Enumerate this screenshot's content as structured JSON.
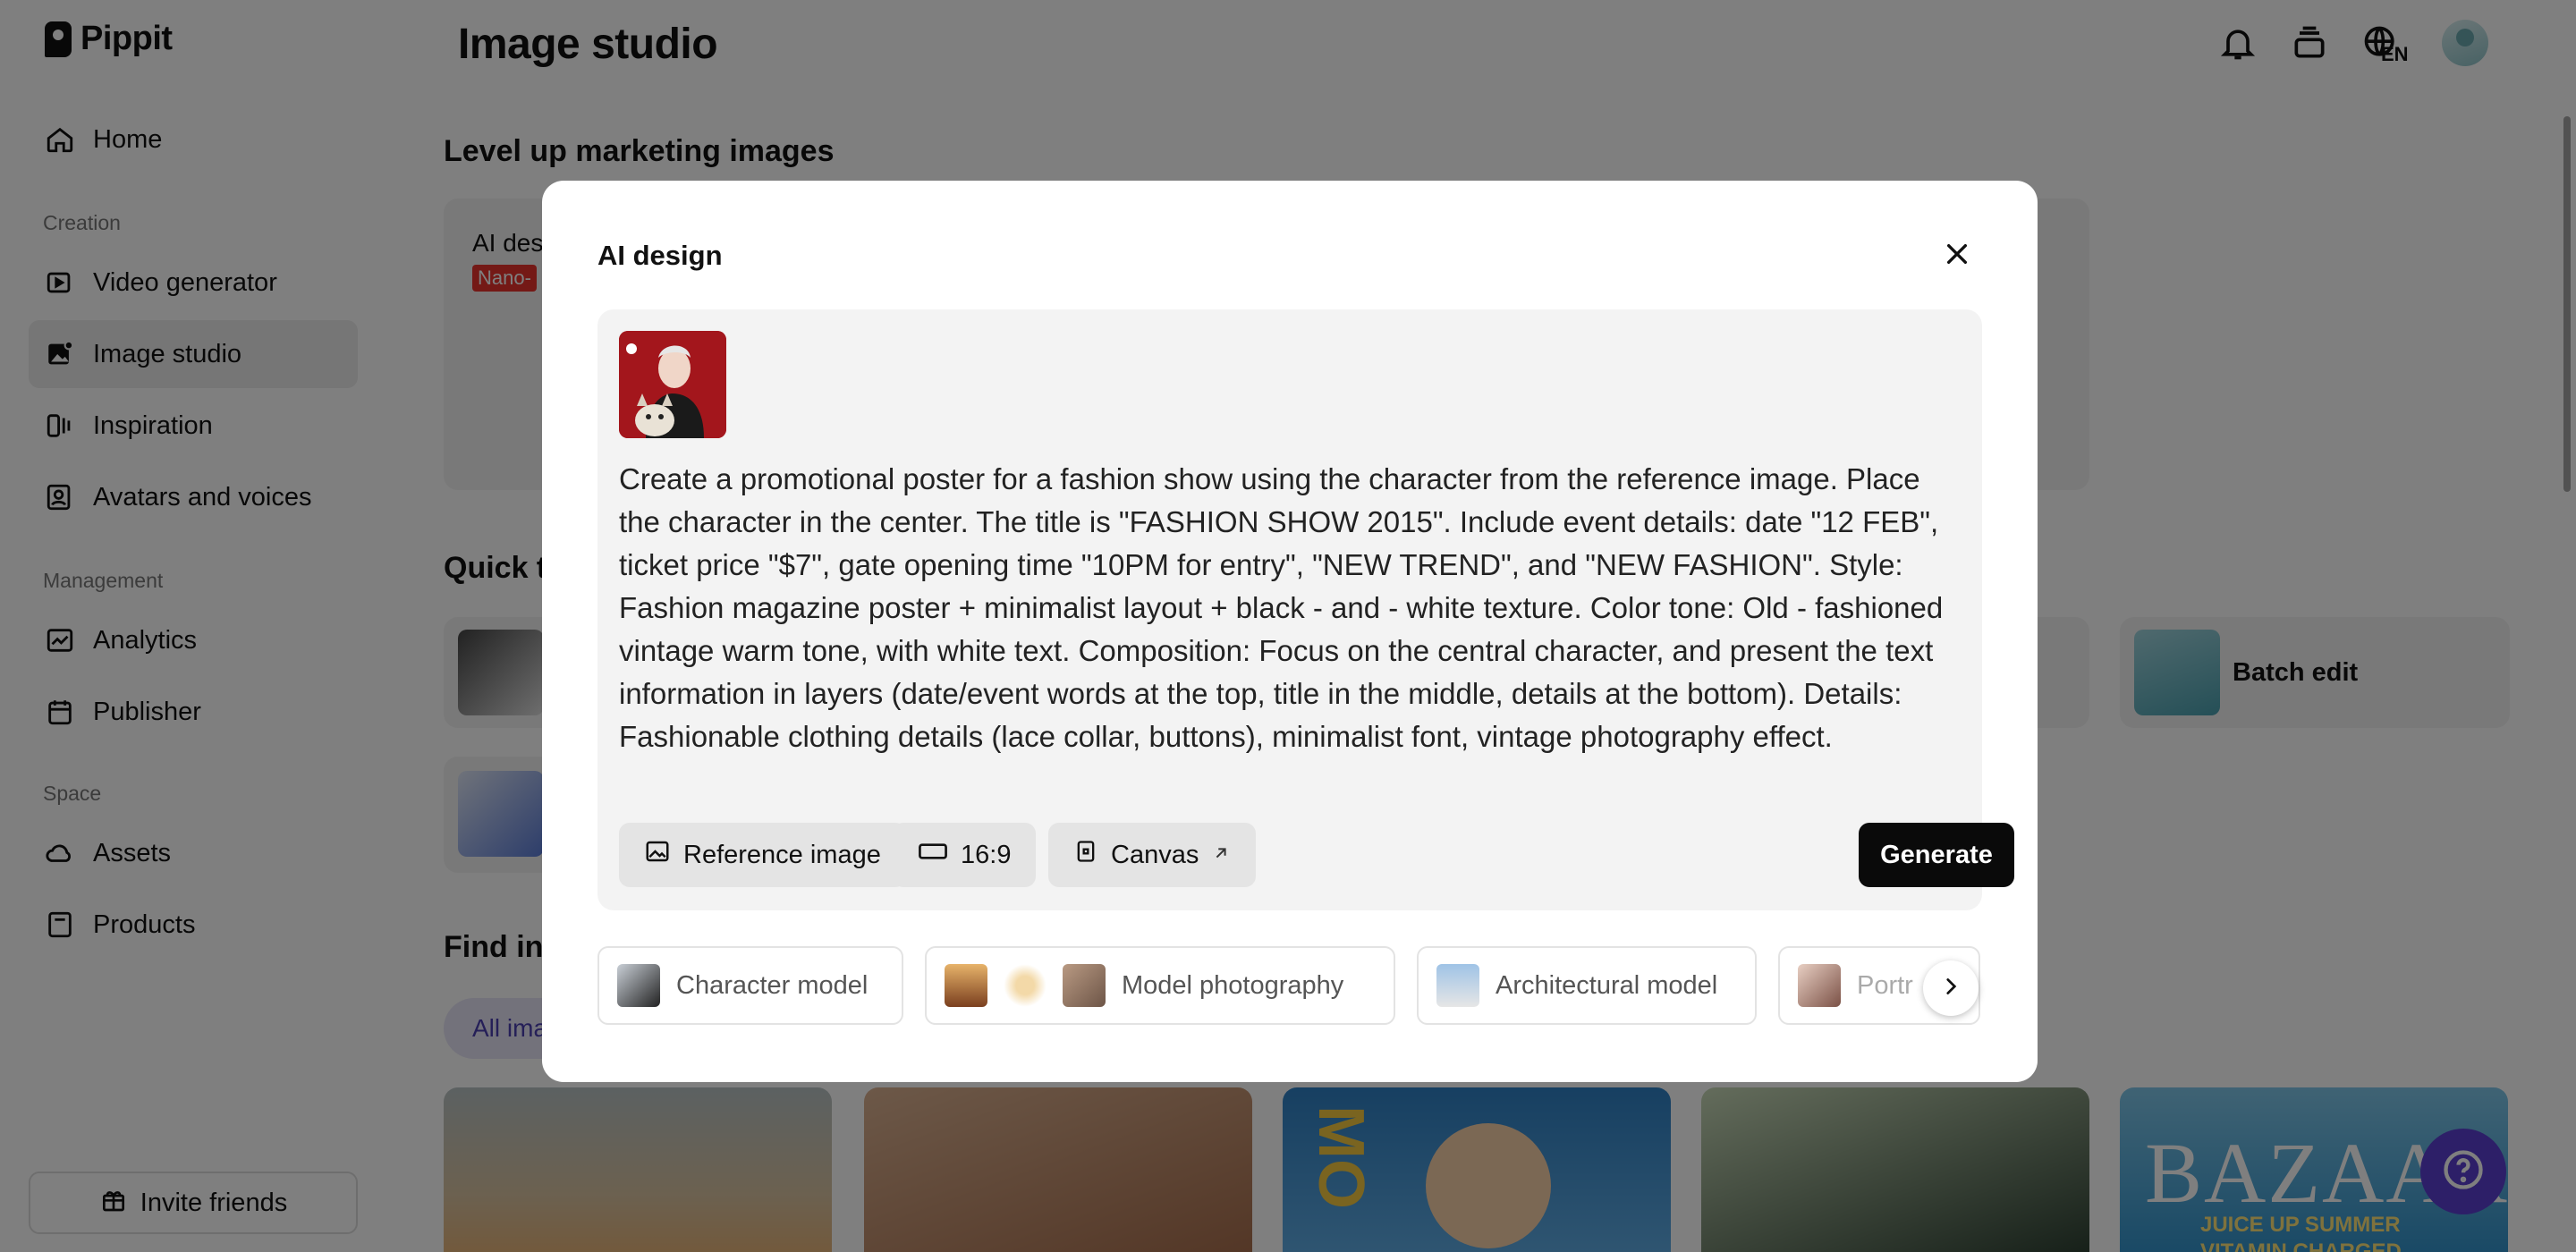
{
  "brand": {
    "name": "Pippit"
  },
  "header": {
    "title": "Image studio",
    "lang": "EN"
  },
  "sidebar": {
    "items": [
      {
        "label": "Home",
        "icon": "home-icon"
      },
      {
        "label": "Video generator",
        "icon": "video-icon"
      },
      {
        "label": "Image studio",
        "icon": "image-icon",
        "active": true
      },
      {
        "label": "Inspiration",
        "icon": "inspiration-icon"
      },
      {
        "label": "Avatars and voices",
        "icon": "avatar-icon"
      },
      {
        "label": "Analytics",
        "icon": "analytics-icon"
      },
      {
        "label": "Publisher",
        "icon": "calendar-icon"
      },
      {
        "label": "Assets",
        "icon": "cloud-icon"
      },
      {
        "label": "Products",
        "icon": "product-icon"
      }
    ],
    "sections": {
      "creation": "Creation",
      "management": "Management",
      "space": "Space"
    },
    "invite": "Invite friends"
  },
  "main": {
    "section1_title": "Level up marketing images",
    "ai_card_title": "AI des",
    "nano_badge": "Nano-",
    "section2_title": "Quick t",
    "batch_edit": "Batch edit",
    "section3_title": "Find ins",
    "filter_chip": "All ima",
    "gallery_text": {
      "bazaar": "BAZAAR",
      "juice": "JUICE UP SUMMER",
      "vitamin": "VITAMIN CHARGED",
      "mo": "MO"
    }
  },
  "modal": {
    "title": "AI design",
    "prompt": "Create a promotional poster for a fashion show using the character from the reference image. Place the character in the center. The title is \"FASHION SHOW 2015\". Include event details: date \"12 FEB\", ticket price \"$7\", gate opening time \"10PM for entry\", \"NEW TREND\", and \"NEW FASHION\". Style: Fashion magazine poster + minimalist layout + black - and - white texture. Color tone: Old - fashioned vintage warm tone, with white text. Composition: Focus on the central character, and present the text information in layers (date/event words at the top, title in the middle, details at the bottom). Details: Fashionable clothing details (lace collar, buttons), minimalist font, vintage photography effect.",
    "reference_label": "Reference image",
    "ratio": "16:9",
    "canvas_label": "Canvas",
    "generate_label": "Generate",
    "suggestions": [
      "Character model",
      "Model photography",
      "Architectural model",
      "Portr"
    ]
  },
  "colors": {
    "accent": "#5b3fd0",
    "badge": "#e8322d",
    "generate": "#0a0a0a"
  }
}
